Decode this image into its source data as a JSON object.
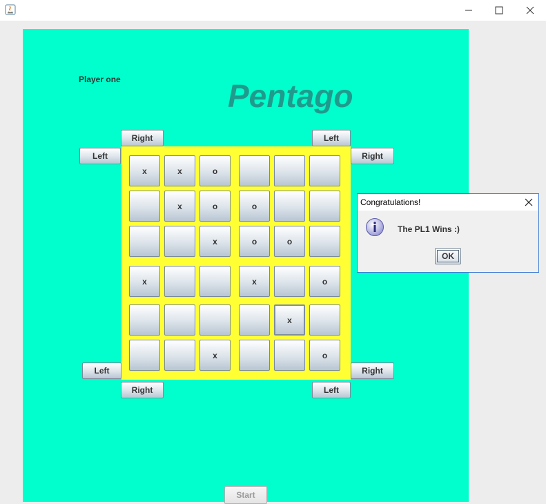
{
  "window": {
    "icon": "java-icon",
    "controls": [
      "minimize-icon",
      "maximize-icon",
      "close-icon"
    ]
  },
  "game": {
    "player_label": "Player one",
    "title": "Pentago",
    "board": [
      [
        "x",
        "x",
        "o",
        "",
        "",
        ""
      ],
      [
        "",
        "x",
        "o",
        "o",
        "",
        ""
      ],
      [
        "",
        "",
        "x",
        "o",
        "o",
        ""
      ],
      [
        "x",
        "",
        "",
        "x",
        "",
        "o"
      ],
      [
        "",
        "",
        "",
        "",
        "x",
        ""
      ],
      [
        "",
        "",
        "x",
        "",
        "",
        "o"
      ]
    ],
    "rotate_buttons": {
      "top_left_top": "Right",
      "top_left_side": "Left",
      "top_right_top": "Left",
      "top_right_side": "Right",
      "bottom_left_side": "Left",
      "bottom_left_bottom": "Right",
      "bottom_right_side": "Right",
      "bottom_right_bottom": "Left"
    },
    "start_label": "Start"
  },
  "dialog": {
    "title": "Congratulations!",
    "message": "The PL1 Wins  :)",
    "ok_label": "OK",
    "icon": "info-icon"
  },
  "colors": {
    "panel": "#00ffcc",
    "board": "#ffff33",
    "title": "#1f9a8c"
  }
}
